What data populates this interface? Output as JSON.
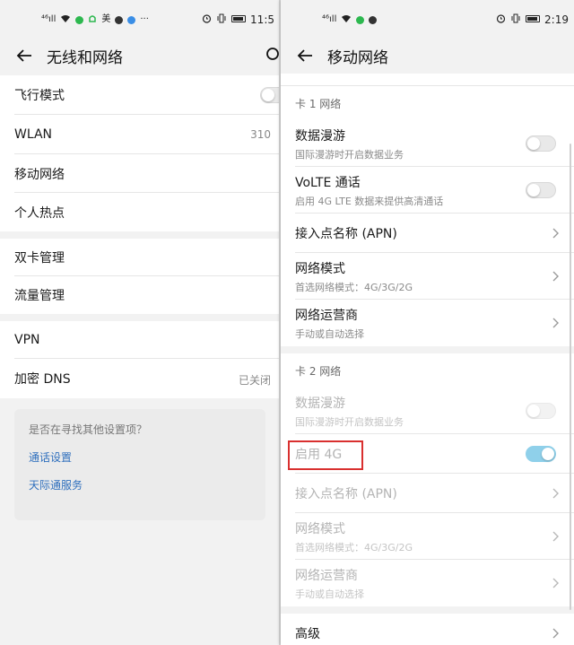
{
  "left": {
    "status": {
      "time": "11:5",
      "carrier_glyph": "⁴⁶ıll",
      "app_char": "美"
    },
    "header": {
      "title": "无线和网络"
    },
    "groups": [
      {
        "rows": [
          {
            "title": "飞行模式",
            "control": "toggle",
            "on": false
          },
          {
            "title": "WLAN",
            "value": "310",
            "control": "chevron"
          },
          {
            "title": "移动网络",
            "control": "chevron"
          },
          {
            "title": "个人热点",
            "control": "chevron"
          }
        ]
      },
      {
        "rows": [
          {
            "title": "双卡管理",
            "control": "chevron"
          },
          {
            "title": "流量管理",
            "control": "chevron"
          }
        ]
      },
      {
        "rows": [
          {
            "title": "VPN",
            "control": "chevron"
          },
          {
            "title": "加密 DNS",
            "value": "已关闭",
            "control": "chevron"
          }
        ]
      }
    ],
    "suggestions": {
      "question": "是否在寻找其他设置项？",
      "links": [
        "通话设置",
        "天际通服务"
      ]
    }
  },
  "right": {
    "status": {
      "time": "2:19",
      "carrier_glyph": "⁴⁶ıll"
    },
    "header": {
      "title": "移动网络"
    },
    "sim1": {
      "label": "卡 1 网络",
      "rows": [
        {
          "title": "数据漫游",
          "sub": "国际漫游时开启数据业务",
          "control": "toggle",
          "on": false
        },
        {
          "title": "VoLTE 通话",
          "sub": "启用 4G LTE 数据来提供高清通话",
          "control": "toggle",
          "on": false
        },
        {
          "title": "接入点名称 (APN)",
          "control": "chevron"
        },
        {
          "title": "网络模式",
          "sub": "首选网络模式：4G/3G/2G",
          "control": "chevron"
        },
        {
          "title": "网络运营商",
          "sub": "手动或自动选择",
          "control": "chevron"
        }
      ]
    },
    "sim2": {
      "label": "卡 2 网络",
      "rows": [
        {
          "title": "数据漫游",
          "sub": "国际漫游时开启数据业务",
          "control": "toggle",
          "on": false
        },
        {
          "title": "启用 4G",
          "control": "toggle",
          "on": true
        },
        {
          "title": "接入点名称 (APN)",
          "control": "chevron"
        },
        {
          "title": "网络模式",
          "sub": "首选网络模式：4G/3G/2G",
          "control": "chevron"
        },
        {
          "title": "网络运营商",
          "sub": "手动或自动选择",
          "control": "chevron"
        }
      ]
    },
    "advanced": {
      "title": "高级"
    }
  },
  "colors": {
    "accent_link": "#2f6fbd",
    "toggle_on": "#8fd0ea",
    "highlight_box": "#d9302f"
  }
}
